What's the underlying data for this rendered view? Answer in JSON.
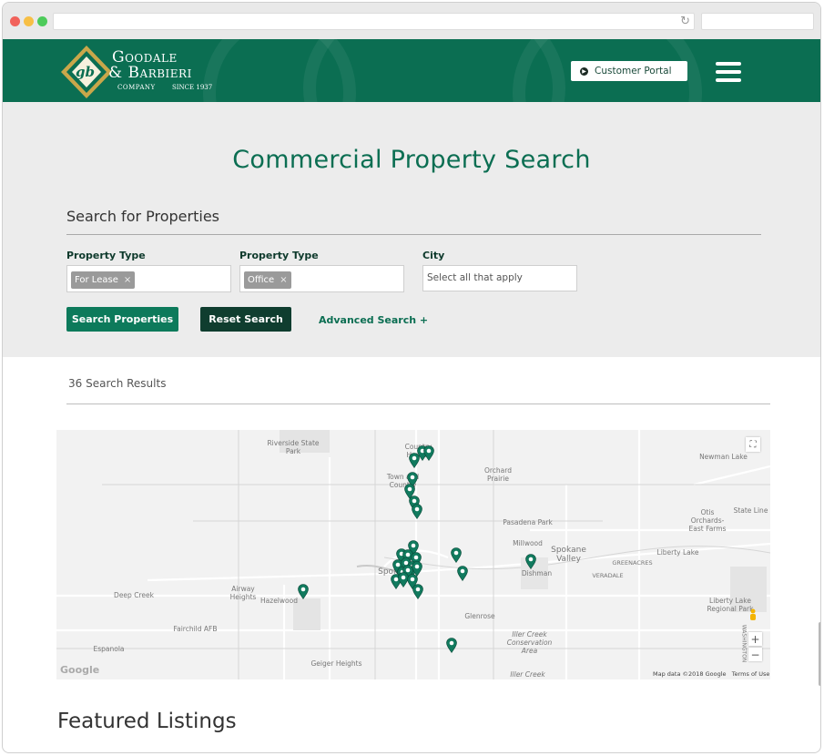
{
  "header": {
    "logo_line1": "Goodale",
    "logo_line2": "& Barbieri",
    "logo_company": "COMPANY",
    "logo_since": "SINCE 1937",
    "portal_label": "Customer Portal"
  },
  "search": {
    "title": "Commercial Property Search",
    "section_title": "Search for Properties",
    "fields": [
      {
        "label": "Property Type",
        "chip": "For Lease"
      },
      {
        "label": "Property Type",
        "chip": "Office"
      },
      {
        "label": "City",
        "placeholder": "Select all that apply"
      }
    ],
    "search_button": "Search Properties",
    "reset_button": "Reset Search",
    "advanced_link": "Advanced Search +"
  },
  "results": {
    "count_text": "36 Search Results"
  },
  "map": {
    "labels": [
      "Riverside State Park",
      "Country Homes",
      "Town and Country",
      "Orchard Prairie",
      "Newman Lake",
      "Otis Orchards-East Farms",
      "State Line",
      "Pasadena Park",
      "Millwood",
      "Spokane Valley",
      "Liberty Lake",
      "GREENACRES",
      "VERADALE",
      "Dishman",
      "Spokane",
      "Airway Heights",
      "Hazelwood",
      "Deep Creek",
      "Fairchild AFB",
      "Espanola",
      "Glenrose",
      "Liberty Lake Regional Park",
      "Iller Creek Conservation Area",
      "Iller Creek",
      "Geiger Heights",
      "WASHINGTON"
    ],
    "google": "Google",
    "attribution": "Map data ©2018 Google",
    "terms": "Terms of Use",
    "pin_color": "#117a5e"
  },
  "featured": {
    "title": "Featured Listings"
  },
  "colors": {
    "brand_green": "#0b6e52",
    "dark_green": "#0e3a2c"
  }
}
